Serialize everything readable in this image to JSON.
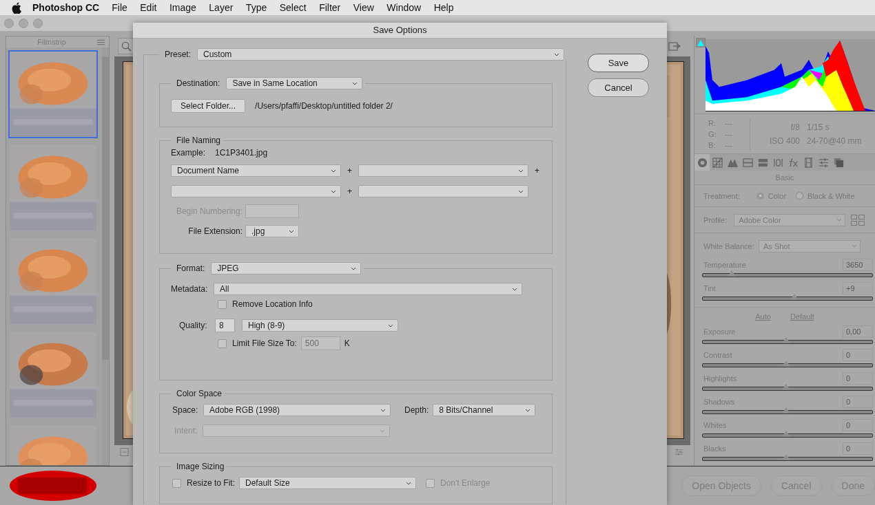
{
  "menubar": {
    "app": "Photoshop CC",
    "items": [
      "File",
      "Edit",
      "Image",
      "Layer",
      "Type",
      "Select",
      "Filter",
      "View",
      "Window",
      "Help"
    ]
  },
  "filmstrip": {
    "title": "Filmstrip",
    "thumbnails": [
      {
        "selected": true
      },
      {
        "selected": false
      },
      {
        "selected": false
      },
      {
        "selected": false
      },
      {
        "selected": false
      }
    ]
  },
  "readout": {
    "rgb": [
      {
        "label": "R:",
        "value": "---"
      },
      {
        "label": "G:",
        "value": "---"
      },
      {
        "label": "B:",
        "value": "---"
      }
    ],
    "exif": [
      [
        "f/8",
        "1/15 s"
      ],
      [
        "ISO 400",
        "24-70@40 mm"
      ]
    ]
  },
  "panel_tabs": [
    {
      "kind": "basic",
      "selected": true
    },
    {
      "kind": "curve",
      "selected": false
    },
    {
      "kind": "detail",
      "selected": false
    },
    {
      "kind": "hsl",
      "selected": false
    },
    {
      "kind": "split",
      "selected": false
    },
    {
      "kind": "lens",
      "selected": false
    },
    {
      "kind": "fx",
      "selected": false
    },
    {
      "kind": "calibration",
      "selected": false
    },
    {
      "kind": "presets",
      "selected": false
    },
    {
      "kind": "snapshots",
      "selected": false
    }
  ],
  "panel": {
    "title": "Basic",
    "treatment": {
      "label": "Treatment:",
      "options": [
        {
          "label": "Color",
          "selected": true
        },
        {
          "label": "Black & White",
          "selected": false
        }
      ]
    },
    "profile": {
      "label": "Profile:",
      "value": "Adobe Color"
    },
    "white_balance": {
      "label": "White Balance:",
      "value": "As Shot"
    },
    "wb_sliders": [
      {
        "label": "Temperature",
        "value": "3650",
        "level": 0.17
      },
      {
        "label": "Tint",
        "value": "+9",
        "level": 0.54
      }
    ],
    "auto": "Auto",
    "default": "Default",
    "tone_sliders": [
      {
        "label": "Exposure",
        "value": "0,00",
        "level": 0.49
      },
      {
        "label": "Contrast",
        "value": "0",
        "level": 0.49
      },
      {
        "label": "Highlights",
        "value": "0",
        "level": 0.49
      },
      {
        "label": "Shadows",
        "value": "0",
        "level": 0.49
      },
      {
        "label": "Whites",
        "value": "0",
        "level": 0.49
      },
      {
        "label": "Blacks",
        "value": "0",
        "level": 0.49
      }
    ]
  },
  "bottom_buttons": [
    "Open Objects",
    "Cancel",
    "Done"
  ],
  "dialog": {
    "title": "Save Options",
    "buttons": [
      "Save",
      "Cancel"
    ],
    "preset": {
      "label": "Preset:",
      "value": "Custom"
    },
    "destination": {
      "label": "Destination:",
      "value": "Save in Same Location",
      "button": "Select Folder...",
      "path": "/Users/pfaffi/Desktop/untitled folder 2/"
    },
    "file_naming": {
      "title": "File Naming",
      "example_label": "Example:",
      "example": "1C1P3401.jpg",
      "first_field": "Document Name",
      "plus": [
        "+",
        "+",
        "+"
      ],
      "begin_numbering": {
        "label": "Begin Numbering:",
        "disabled": true
      },
      "extension": {
        "label": "File Extension:",
        "value": ".jpg"
      }
    },
    "format": {
      "label": "Format:",
      "value": "JPEG",
      "metadata": {
        "label": "Metadata:",
        "value": "All"
      },
      "remove_location": {
        "label": "Remove Location Info",
        "checked": false
      },
      "quality": {
        "label": "Quality:",
        "value": "8",
        "preset": "High  (8-9)"
      },
      "limit": {
        "label": "Limit File Size To:",
        "checked": false,
        "value": "500",
        "unit": "K",
        "disabled": true
      }
    },
    "color_space": {
      "title": "Color Space",
      "space": {
        "label": "Space:",
        "value": "Adobe RGB (1998)"
      },
      "depth": {
        "label": "Depth:",
        "value": "8 Bits/Channel"
      },
      "intent": {
        "label": "Intent:",
        "disabled": true
      }
    },
    "image_sizing": {
      "title": "Image Sizing",
      "resize": {
        "label": "Resize to Fit:",
        "checked": false,
        "value": "Default Size"
      },
      "dont_enlarge": {
        "label": "Don't Enlarge",
        "checked": false,
        "disabled": true
      }
    }
  }
}
